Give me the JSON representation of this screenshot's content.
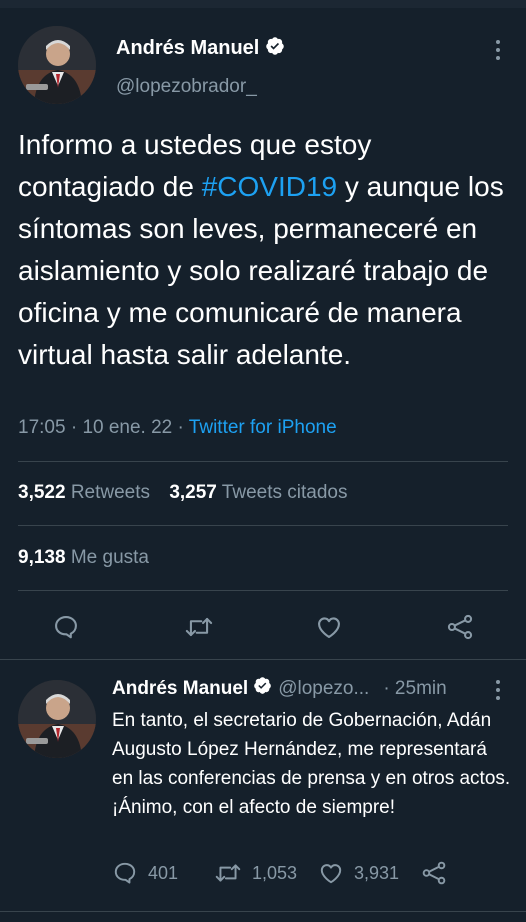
{
  "main_tweet": {
    "author_name": "Andrés Manuel",
    "handle": "@lopezobrador_",
    "text_before": "Informo a ustedes que estoy contagiado de ",
    "hashtag": "#COVID19",
    "text_after": " y aunque los síntomas son leves, permaneceré en aislamiento y solo realizaré trabajo de oficina y me comunicaré de manera virtual hasta salir adelante.",
    "time": "17:05",
    "date": "10 ene. 22",
    "source": "Twitter for iPhone",
    "retweets_count": "3,522",
    "retweets_label": "Retweets",
    "quotes_count": "3,257",
    "quotes_label": "Tweets citados",
    "likes_count": "9,138",
    "likes_label": "Me gusta",
    "action_icons": [
      "reply-icon",
      "retweet-icon",
      "like-icon",
      "share-icon"
    ]
  },
  "reply_tweet": {
    "author_name": "Andrés Manuel",
    "handle": "@lopezo...",
    "age": "· 25min",
    "text": "En tanto, el secretario de Gobernación, Adán Augusto López Hernández, me representará en las conferencias de prensa y en otros actos.\n¡Ánimo, con el afecto de siempre!",
    "replies": "401",
    "retweets": "1,053",
    "likes": "3,931"
  },
  "colors": {
    "background": "#15202b",
    "accent": "#1da1f2",
    "muted": "#8899a6",
    "divider": "#38444d"
  }
}
